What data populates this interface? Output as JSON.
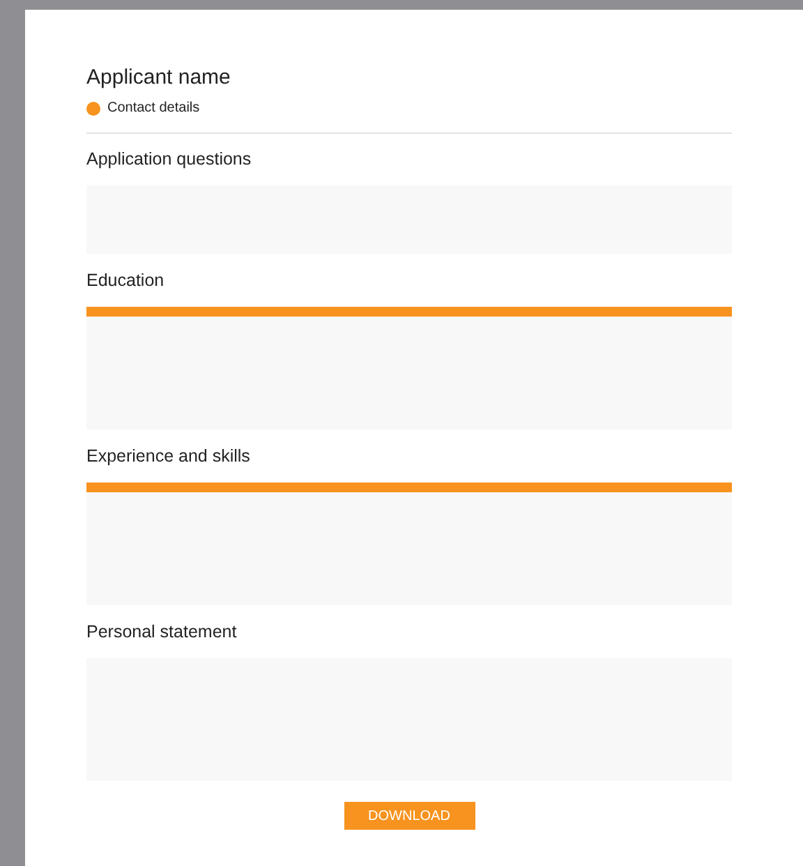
{
  "applicant": {
    "name": "Applicant name",
    "contact": {
      "label": "Contact details",
      "color": "#f7931e"
    }
  },
  "sections": [
    {
      "title": "Application questions",
      "kind": "short",
      "flagged": false
    },
    {
      "title": "Education",
      "kind": "tall",
      "flagged": true
    },
    {
      "title": "Experience and skills",
      "kind": "tall",
      "flagged": true
    },
    {
      "title": "Personal statement",
      "kind": "tall",
      "flagged": false
    }
  ],
  "download_button": "DOWNLOAD"
}
